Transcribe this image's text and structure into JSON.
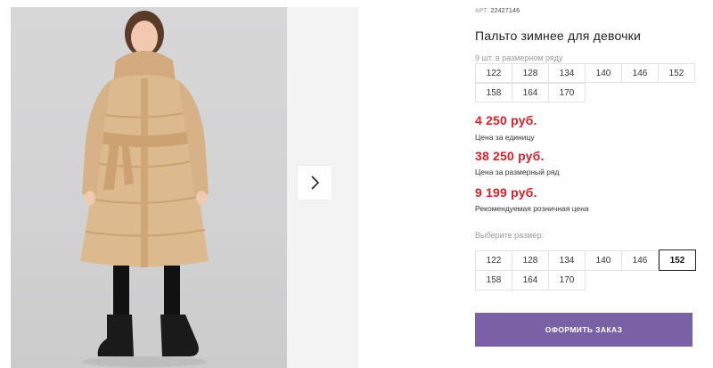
{
  "product": {
    "article_label": "АРТ.",
    "article_code": "22427146",
    "title": "Пальто зимнее для девочки"
  },
  "pack": {
    "label": "9 шт. в размерном ряду",
    "sizes": [
      "122",
      "128",
      "134",
      "140",
      "146",
      "152",
      "158",
      "164",
      "170"
    ]
  },
  "prices": [
    {
      "value": "4 250 руб.",
      "note": "Цена за единицу"
    },
    {
      "value": "38 250 руб.",
      "note": "Цена за размерный ряд"
    },
    {
      "value": "9 199 руб.",
      "note": "Рекомендуемая розничная цена"
    }
  ],
  "size_select": {
    "label": "Выберите размер:",
    "sizes": [
      "122",
      "128",
      "134",
      "140",
      "146",
      "152",
      "158",
      "164",
      "170"
    ],
    "selected": "152"
  },
  "order_button": "ОФОРМИТЬ ЗАКАЗ",
  "icons": {
    "next": "chevron-right-icon"
  },
  "colors": {
    "price": "#d4212b",
    "button": "#7a61a6",
    "coat": "#ddb98e"
  }
}
